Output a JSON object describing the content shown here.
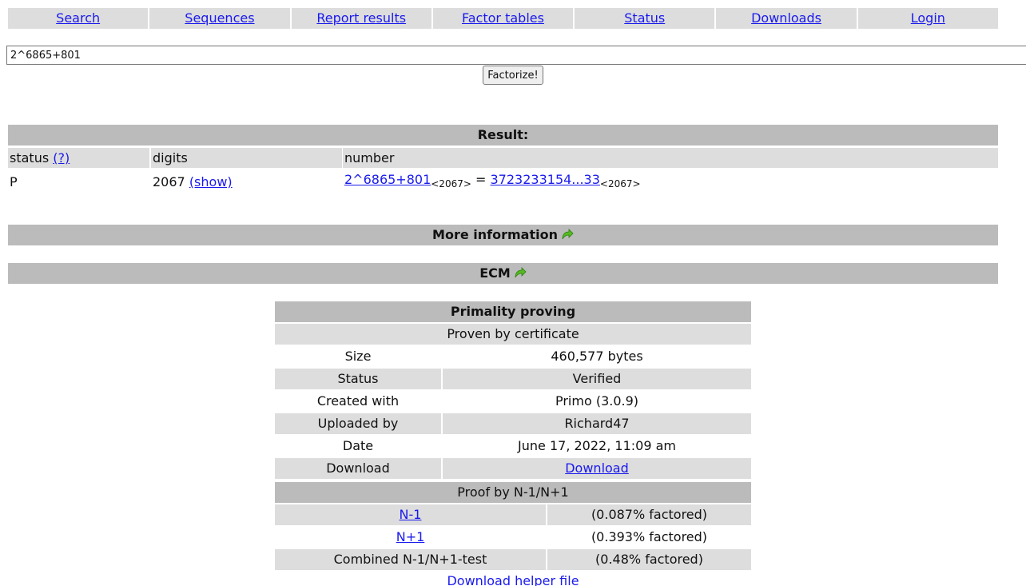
{
  "nav": [
    {
      "label": "Search"
    },
    {
      "label": "Sequences"
    },
    {
      "label": "Report results"
    },
    {
      "label": "Factor tables"
    },
    {
      "label": "Status"
    },
    {
      "label": "Downloads"
    },
    {
      "label": "Login"
    }
  ],
  "search": {
    "value": "2^6865+801",
    "button": "Factorize!"
  },
  "result": {
    "heading": "Result:",
    "headers": {
      "status": "status",
      "status_help": "(?)",
      "digits": "digits",
      "number": "number"
    },
    "row": {
      "status": "P",
      "digits": "2067",
      "show": "(show)",
      "expr": "2^6865+801",
      "expr_digits": "<2067>",
      "equals": "=",
      "value": "3723233154...33",
      "value_digits": "<2067>"
    }
  },
  "sections": {
    "more_info": "More information",
    "ecm": "ECM"
  },
  "colors": {
    "arrow": "#55bb22",
    "link": "#1a1aee",
    "dark_bar": "#bbbbbb",
    "light_bar": "#dddddd"
  },
  "primality": {
    "title": "Primality proving",
    "subtitle": "Proven by certificate",
    "rows": [
      {
        "label": "Size",
        "value": "460,577 bytes"
      },
      {
        "label": "Status",
        "value": "Verified"
      },
      {
        "label": "Created with",
        "value": "Primo (3.0.9)"
      },
      {
        "label": "Uploaded by",
        "value": "Richard47"
      },
      {
        "label": "Date",
        "value": "June 17, 2022, 11:09 am"
      },
      {
        "label": "Download",
        "value": "Download"
      }
    ],
    "proof_title": "Proof by N-1/N+1",
    "proof_rows": [
      {
        "label": "N-1",
        "value": "(0.087% factored)"
      },
      {
        "label": "N+1",
        "value": "(0.393% factored)"
      },
      {
        "label": "Combined N-1/N+1-test",
        "value": "(0.48% factored)"
      }
    ],
    "helper": "Download helper file"
  }
}
